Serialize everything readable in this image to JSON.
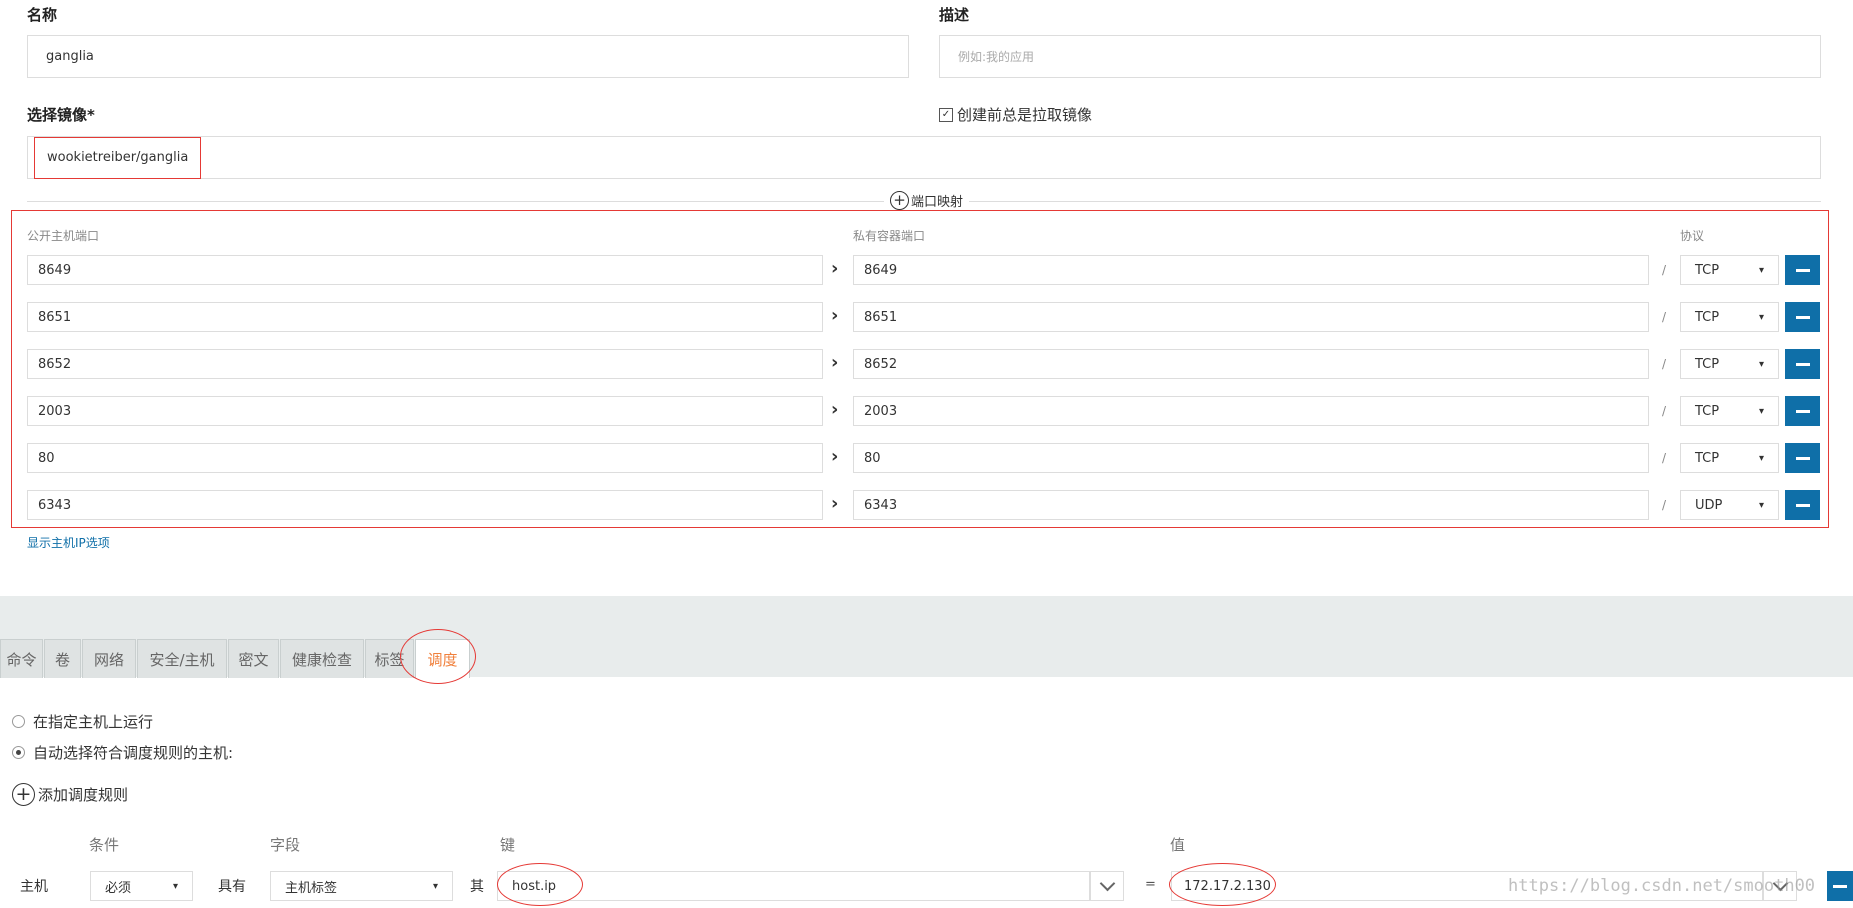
{
  "form": {
    "name_label": "名称",
    "name_value": "ganglia",
    "desc_label": "描述",
    "desc_placeholder": "例如:我的应用",
    "image_label": "选择镜像*",
    "image_value": "wookietreiber/ganglia",
    "pull_label": "创建前总是拉取镜像",
    "pull_checked": true,
    "port_mapping_label": "端口映射"
  },
  "ports": {
    "public_header": "公开主机端口",
    "private_header": "私有容器端口",
    "protocol_header": "协议",
    "rows": [
      {
        "public": "8649",
        "private": "8649",
        "protocol": "TCP"
      },
      {
        "public": "8651",
        "private": "8651",
        "protocol": "TCP"
      },
      {
        "public": "8652",
        "private": "8652",
        "protocol": "TCP"
      },
      {
        "public": "2003",
        "private": "2003",
        "protocol": "TCP"
      },
      {
        "public": "80",
        "private": "80",
        "protocol": "TCP"
      },
      {
        "public": "6343",
        "private": "6343",
        "protocol": "UDP"
      }
    ],
    "show_ip_link": "显示主机IP选项"
  },
  "tabs": [
    {
      "label": "命令"
    },
    {
      "label": "卷"
    },
    {
      "label": "网络"
    },
    {
      "label": "安全/主机"
    },
    {
      "label": "密文"
    },
    {
      "label": "健康检查"
    },
    {
      "label": "标签"
    },
    {
      "label": "调度",
      "active": true
    }
  ],
  "scheduling": {
    "radio_specific": "在指定主机上运行",
    "radio_auto": "自动选择符合调度规则的主机:",
    "add_rule": "添加调度规则",
    "col_condition": "条件",
    "col_field": "字段",
    "col_key": "键",
    "col_value": "值",
    "rule": {
      "target": "主机",
      "condition": "必须",
      "has": "具有",
      "field": "主机标签",
      "its": "其",
      "key": "host.ip",
      "equals": "=",
      "value": "172.17.2.130"
    }
  },
  "watermark": "https://blog.csdn.net/smooth00",
  "colors": {
    "accent": "#0f6fa8",
    "active_tab": "#f0803c",
    "highlight": "#e53935"
  }
}
